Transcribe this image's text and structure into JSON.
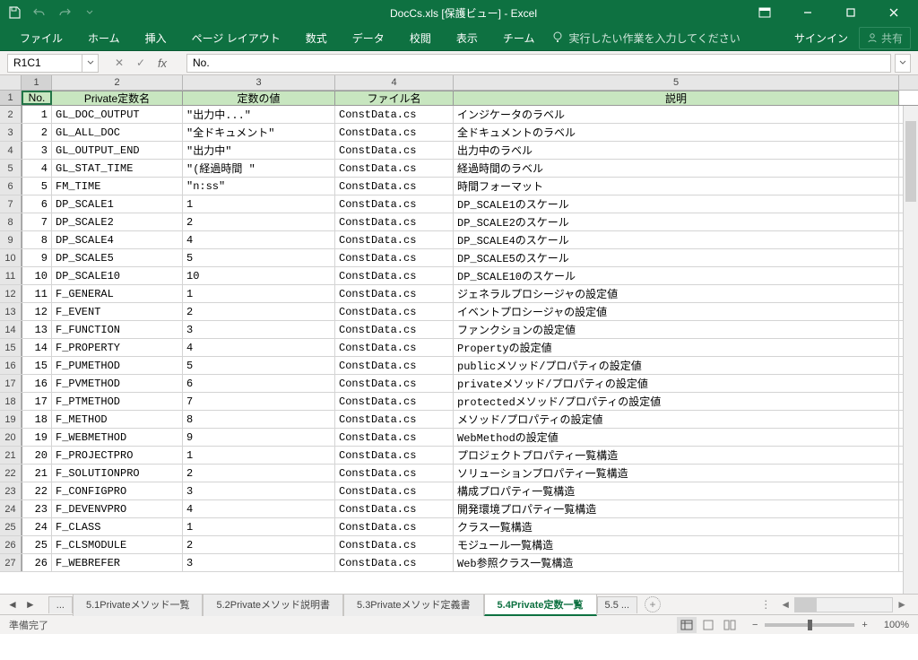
{
  "title": "DocCs.xls [保護ビュー] - Excel",
  "ribbon": {
    "tabs": [
      "ファイル",
      "ホーム",
      "挿入",
      "ページ レイアウト",
      "数式",
      "データ",
      "校閲",
      "表示",
      "チーム"
    ],
    "tellme": "実行したい作業を入力してください",
    "signin": "サインイン",
    "share": "共有"
  },
  "namebox": "R1C1",
  "formula": "No.",
  "cols": [
    "1",
    "2",
    "3",
    "4",
    "5"
  ],
  "widths": [
    34,
    146,
    170,
    132,
    497
  ],
  "header": [
    "No.",
    "Private定数名",
    "定数の値",
    "ファイル名",
    "説明"
  ],
  "rows": [
    [
      "1",
      "GL_DOC_OUTPUT",
      "\"出力中...\"",
      "ConstData.cs",
      "インジケータのラベル"
    ],
    [
      "2",
      "GL_ALL_DOC",
      "\"全ドキュメント\"",
      "ConstData.cs",
      "全ドキュメントのラベル"
    ],
    [
      "3",
      "GL_OUTPUT_END",
      "\"出力中\"",
      "ConstData.cs",
      "出力中のラベル"
    ],
    [
      "4",
      "GL_STAT_TIME",
      "\"(経過時間 \"",
      "ConstData.cs",
      "経過時間のラベル"
    ],
    [
      "5",
      "FM_TIME",
      "\"n:ss\"",
      "ConstData.cs",
      "時間フォーマット"
    ],
    [
      "6",
      "DP_SCALE1",
      "1",
      "ConstData.cs",
      "DP_SCALE1のスケール"
    ],
    [
      "7",
      "DP_SCALE2",
      "2",
      "ConstData.cs",
      "DP_SCALE2のスケール"
    ],
    [
      "8",
      "DP_SCALE4",
      "4",
      "ConstData.cs",
      "DP_SCALE4のスケール"
    ],
    [
      "9",
      "DP_SCALE5",
      "5",
      "ConstData.cs",
      "DP_SCALE5のスケール"
    ],
    [
      "10",
      "DP_SCALE10",
      "10",
      "ConstData.cs",
      "DP_SCALE10のスケール"
    ],
    [
      "11",
      "F_GENERAL",
      "1",
      "ConstData.cs",
      "ジェネラルプロシージャの設定値"
    ],
    [
      "12",
      "F_EVENT",
      "2",
      "ConstData.cs",
      "イベントプロシージャの設定値"
    ],
    [
      "13",
      "F_FUNCTION",
      "3",
      "ConstData.cs",
      "ファンクションの設定値"
    ],
    [
      "14",
      "F_PROPERTY",
      "4",
      "ConstData.cs",
      "Propertyの設定値"
    ],
    [
      "15",
      "F_PUMETHOD",
      "5",
      "ConstData.cs",
      "publicメソッド/プロパティの設定値"
    ],
    [
      "16",
      "F_PVMETHOD",
      "6",
      "ConstData.cs",
      "privateメソッド/プロパティの設定値"
    ],
    [
      "17",
      "F_PTMETHOD",
      "7",
      "ConstData.cs",
      "protectedメソッド/プロパティの設定値"
    ],
    [
      "18",
      "F_METHOD",
      "8",
      "ConstData.cs",
      "メソッド/プロパティの設定値"
    ],
    [
      "19",
      "F_WEBMETHOD",
      "9",
      "ConstData.cs",
      "WebMethodの設定値"
    ],
    [
      "20",
      "F_PROJECTPRO",
      "1",
      "ConstData.cs",
      "プロジェクトプロパティ一覧構造"
    ],
    [
      "21",
      "F_SOLUTIONPRO",
      "2",
      "ConstData.cs",
      "ソリューションプロパティ一覧構造"
    ],
    [
      "22",
      "F_CONFIGPRO",
      "3",
      "ConstData.cs",
      "構成プロパティ一覧構造"
    ],
    [
      "23",
      "F_DEVENVPRO",
      "4",
      "ConstData.cs",
      "開発環境プロパティ一覧構造"
    ],
    [
      "24",
      "F_CLASS",
      "1",
      "ConstData.cs",
      "クラス一覧構造"
    ],
    [
      "25",
      "F_CLSMODULE",
      "2",
      "ConstData.cs",
      "モジュール一覧構造"
    ],
    [
      "26",
      "F_WEBREFER",
      "3",
      "ConstData.cs",
      "Web参照クラス一覧構造"
    ]
  ],
  "sheet_tabs": {
    "more": "...",
    "items": [
      "5.1Privateメソッド一覧",
      "5.2Privateメソッド説明書",
      "5.3Privateメソッド定義書",
      "5.4Private定数一覧"
    ],
    "next": "5.5 ...",
    "active": 3
  },
  "status": "準備完了",
  "zoom": "100%"
}
